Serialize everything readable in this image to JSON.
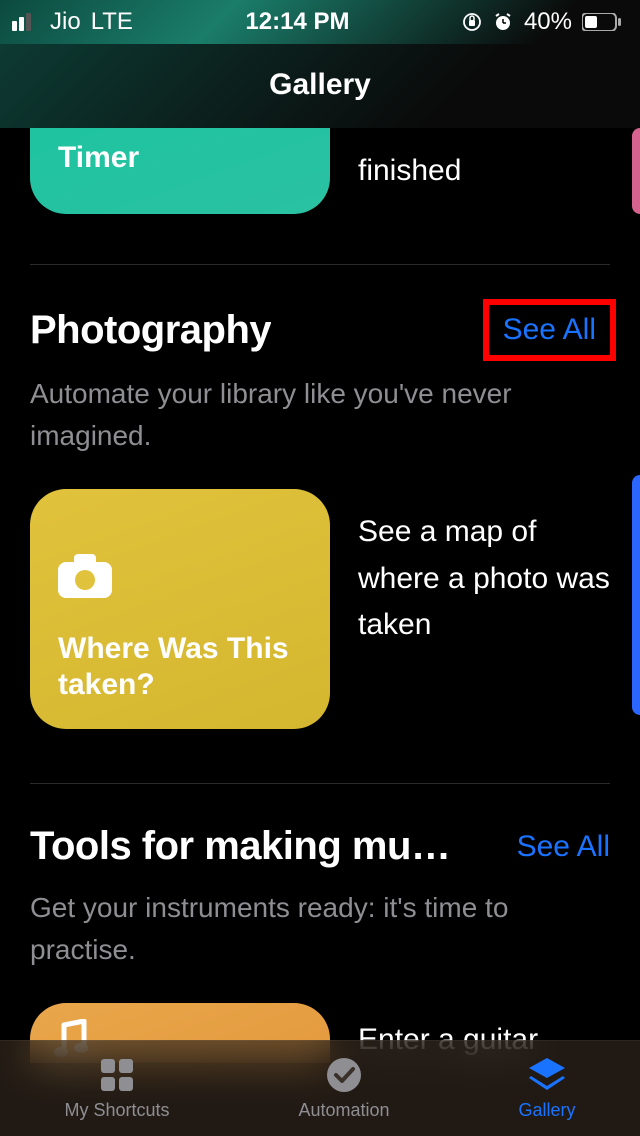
{
  "status": {
    "carrier": "Jio",
    "network": "LTE",
    "time": "12:14 PM",
    "battery_pct": "40%"
  },
  "nav": {
    "title": "Gallery"
  },
  "top_row": {
    "card_title": "Timer",
    "desc": "finished"
  },
  "photography": {
    "title": "Photography",
    "see_all": "See All",
    "subtitle": "Automate your library like you've never imagined.",
    "card_title": "Where Was This taken?",
    "desc": "See a map of where a photo was taken"
  },
  "music": {
    "title": "Tools for making mu…",
    "see_all": "See All",
    "subtitle": "Get your instruments ready: it's time to practise.",
    "desc": "Enter a guitar"
  },
  "tabs": {
    "shortcuts": "My Shortcuts",
    "automation": "Automation",
    "gallery": "Gallery"
  }
}
